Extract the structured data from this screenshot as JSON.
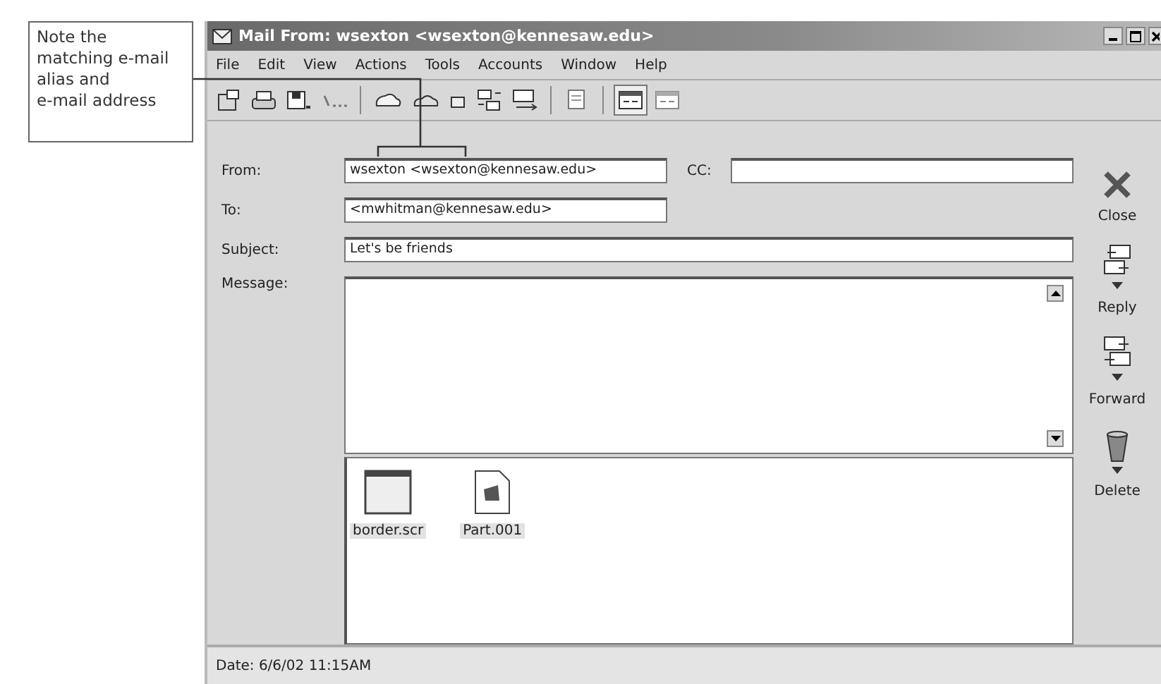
{
  "callout": {
    "text": "Note the\nmatching e-mail\nalias and\ne-mail address"
  },
  "window": {
    "title": "Mail From: wsexton <wsexton@kennesaw.edu>"
  },
  "menu": [
    "File",
    "Edit",
    "View",
    "Actions",
    "Tools",
    "Accounts",
    "Window",
    "Help"
  ],
  "form": {
    "from": {
      "label": "From:",
      "value": "wsexton <wsexton@kennesaw.edu>"
    },
    "cc": {
      "label": "CC:"
    },
    "to": {
      "label": "To:",
      "value": "<mwhitman@kennesaw.edu>"
    },
    "subject": {
      "label": "Subject:",
      "value": "Let's be friends"
    },
    "message": {
      "label": "Message:"
    }
  },
  "attachments": [
    {
      "kind": "window",
      "name": "border.scr"
    },
    {
      "kind": "document",
      "name": "Part.001"
    }
  ],
  "actions": [
    {
      "kind": "close",
      "label": "Close"
    },
    {
      "kind": "reply",
      "label": "Reply"
    },
    {
      "kind": "forward",
      "label": "Forward"
    },
    {
      "kind": "delete",
      "label": "Delete"
    }
  ],
  "status_bar": "Date: 6/6/02 11:15AM"
}
